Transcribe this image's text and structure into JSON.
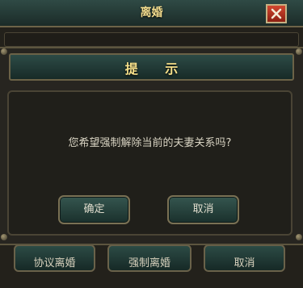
{
  "background_window": {
    "title": "离婚",
    "close_icon": "close-x-icon",
    "buttons": [
      "协议离婚",
      "强制离婚",
      "取消"
    ]
  },
  "dialog": {
    "title": "提 示",
    "message": "您希望强制解除当前的夫妻关系吗?",
    "confirm_label": "确定",
    "cancel_label": "取消"
  },
  "colors": {
    "title_gold": "#f3dd8e",
    "panel_teal": "#2d4b46",
    "close_red": "#c8402b"
  }
}
